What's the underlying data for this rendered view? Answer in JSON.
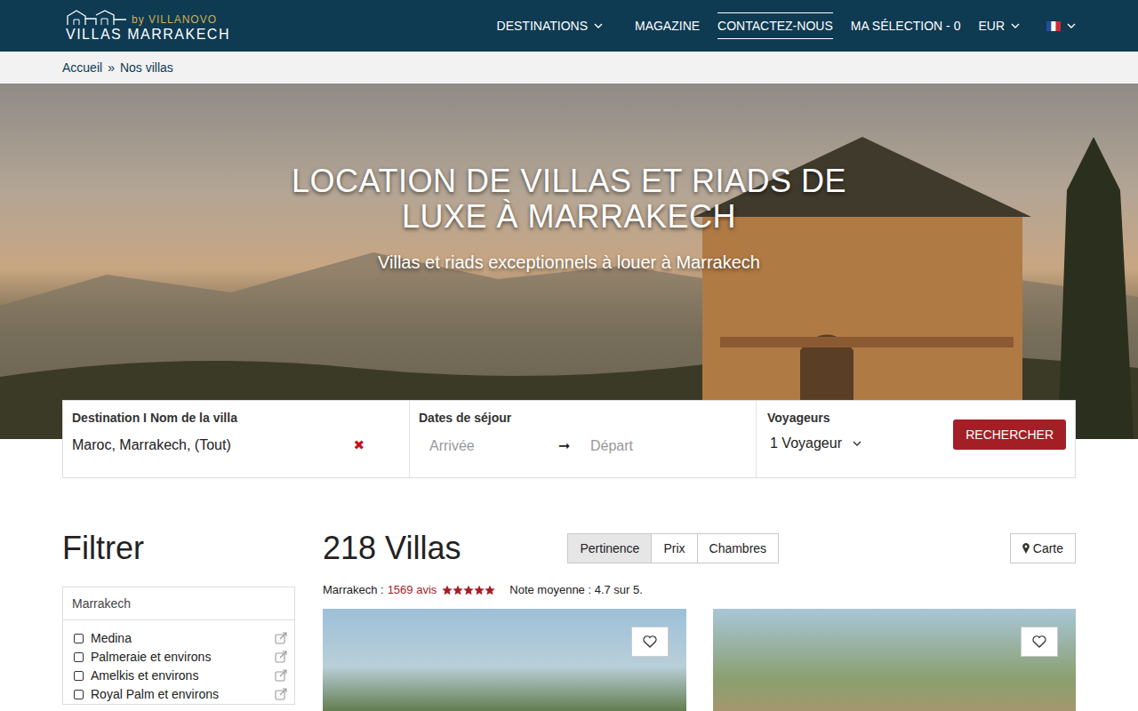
{
  "header": {
    "logo": {
      "tagline": "by VILLANOVO",
      "name": "VILLAS MARRAKECH"
    },
    "nav": [
      {
        "label": "DESTINATIONS",
        "kind": "dropdown",
        "selected": false
      },
      {
        "label": "MAGAZINE",
        "kind": "link",
        "selected": false
      },
      {
        "label": "CONTACTEZ-NOUS",
        "kind": "link",
        "selected": true
      },
      {
        "label": "MA SÉLECTION - 0",
        "kind": "link",
        "selected": false
      },
      {
        "label": "EUR",
        "kind": "dropdown",
        "selected": false
      }
    ]
  },
  "breadcrumb": {
    "items": [
      "Accueil",
      "Nos villas"
    ],
    "separator": "»"
  },
  "hero": {
    "title_lines": [
      "LOCATION DE VILLAS ET RIADS DE",
      "LUXE À MARRAKECH"
    ],
    "subtitle": "Villas et riads exceptionnels à louer à Marrakech"
  },
  "search": {
    "destination": {
      "label": "Destination I Nom de la villa",
      "value": "Maroc, Marrakech, (Tout)",
      "clear": "✖"
    },
    "dates": {
      "label": "Dates de séjour",
      "arrival_placeholder": "Arrivée",
      "arrow": "➞",
      "departure_placeholder": "Départ"
    },
    "guests": {
      "label": "Voyageurs",
      "value": "1 Voyageur"
    },
    "button": "RECHERCHER"
  },
  "filter": {
    "title": "Filtrer",
    "group": "Marrakech",
    "items": [
      {
        "label": "Medina",
        "checked": false
      },
      {
        "label": "Palmeraie et environs",
        "checked": false
      },
      {
        "label": "Amelkis et environs",
        "checked": false
      },
      {
        "label": "Royal Palm et environs",
        "checked": false
      }
    ]
  },
  "results": {
    "count": "218 Villas",
    "sort": [
      {
        "label": "Pertinence",
        "selected": true
      },
      {
        "label": "Prix",
        "selected": false
      },
      {
        "label": "Chambres",
        "selected": false
      }
    ],
    "map_button": "Carte",
    "rating": {
      "place": "Marrakech :",
      "reviews": "1569 avis",
      "stars": 5,
      "average": "Note moyenne : 4.7 sur 5."
    },
    "cards": [
      {
        "favorite": false
      },
      {
        "favorite": false
      }
    ]
  }
}
